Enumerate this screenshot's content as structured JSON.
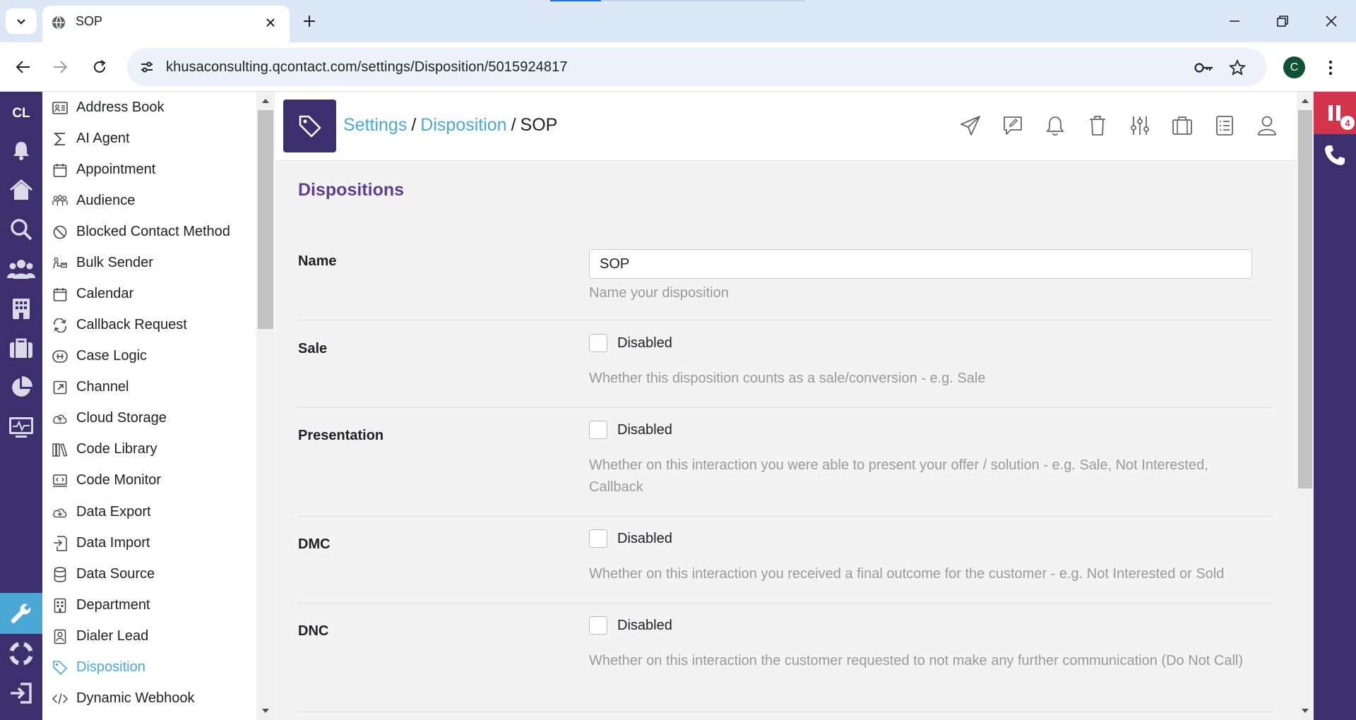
{
  "browser": {
    "tab_title": "SOP",
    "url": "khusaconsulting.qcontact.com/settings/Disposition/5015924817",
    "profile_initial": "C"
  },
  "rail": {
    "brand": "CL",
    "items": [
      "bell-icon",
      "home-icon",
      "search-icon",
      "people-icon",
      "building-icon",
      "briefcase-icon",
      "pie-chart-icon",
      "monitor-icon",
      "wrench-icon",
      "lifebuoy-icon",
      "logout-icon"
    ],
    "active_item": "wrench-icon",
    "accent_color": "#3b2f6d",
    "active_color": "#4aa7d6"
  },
  "settings_list": {
    "items": [
      {
        "label": "Address Book",
        "icon": "address-book-icon"
      },
      {
        "label": "AI Agent",
        "icon": "sigma-icon"
      },
      {
        "label": "Appointment",
        "icon": "calendar-icon"
      },
      {
        "label": "Audience",
        "icon": "audience-icon"
      },
      {
        "label": "Blocked Contact Method",
        "icon": "blocked-icon"
      },
      {
        "label": "Bulk Sender",
        "icon": "bulk-sender-icon"
      },
      {
        "label": "Calendar",
        "icon": "calendar-icon"
      },
      {
        "label": "Callback Request",
        "icon": "refresh-icon"
      },
      {
        "label": "Case Logic",
        "icon": "case-logic-icon"
      },
      {
        "label": "Channel",
        "icon": "external-link-icon"
      },
      {
        "label": "Cloud Storage",
        "icon": "cloud-icon"
      },
      {
        "label": "Code Library",
        "icon": "library-icon"
      },
      {
        "label": "Code Monitor",
        "icon": "code-monitor-icon"
      },
      {
        "label": "Data Export",
        "icon": "data-export-icon"
      },
      {
        "label": "Data Import",
        "icon": "data-import-icon"
      },
      {
        "label": "Data Source",
        "icon": "database-icon"
      },
      {
        "label": "Department",
        "icon": "department-icon"
      },
      {
        "label": "Dialer Lead",
        "icon": "contact-card-icon"
      },
      {
        "label": "Disposition",
        "icon": "tag-icon"
      },
      {
        "label": "Dynamic Webhook",
        "icon": "code-icon"
      }
    ],
    "active_label": "Disposition"
  },
  "header": {
    "crumb_settings": "Settings",
    "crumb_disposition": "Disposition",
    "crumb_current": "SOP",
    "separator": "/",
    "icons": [
      "send-icon",
      "note-icon",
      "bell-icon",
      "trash-icon",
      "sliders-icon",
      "briefcase-icon",
      "list-icon",
      "user-icon"
    ]
  },
  "form": {
    "section_title": "Dispositions",
    "name": {
      "label": "Name",
      "value": "SOP",
      "help": "Name your disposition"
    },
    "sale": {
      "label": "Sale",
      "state": "Disabled",
      "help": "Whether this disposition counts as a sale/conversion - e.g. Sale"
    },
    "presentation": {
      "label": "Presentation",
      "state": "Disabled",
      "help": "Whether on this interaction you were able to present your offer / solution - e.g. Sale, Not Interested, Callback"
    },
    "dmc": {
      "label": "DMC",
      "state": "Disabled",
      "help": "Whether on this interaction you received a final outcome for the customer - e.g. Not Interested or Sold"
    },
    "dnc": {
      "label": "DNC",
      "state": "Disabled",
      "help": "Whether on this interaction the customer requested to not make any further communication (Do Not Call)"
    }
  },
  "right_rail": {
    "pause_count": "4"
  }
}
